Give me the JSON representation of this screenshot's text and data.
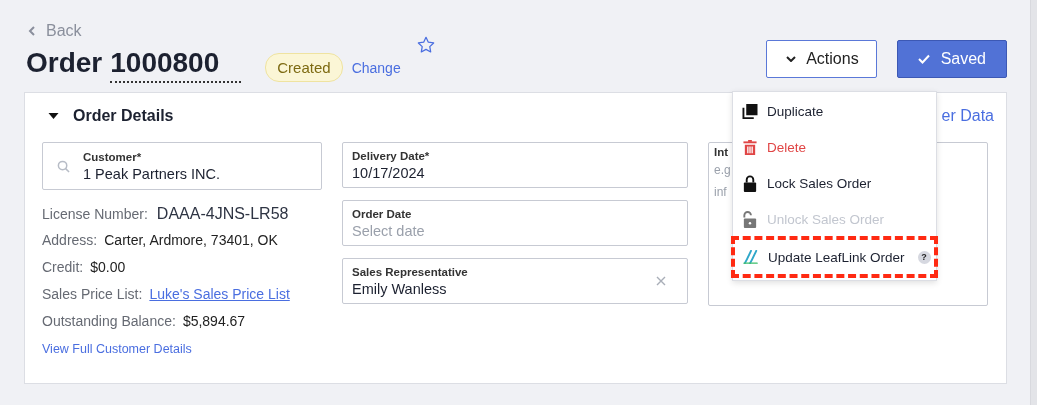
{
  "back": {
    "label": "Back"
  },
  "order": {
    "prefix": "Order",
    "number": "1000800",
    "status": "Created",
    "change_link": "Change",
    "favorite": false
  },
  "actions": {
    "label": "Actions",
    "expanded": true,
    "menu": [
      {
        "label": "Duplicate",
        "kind": "duplicate",
        "disabled": false,
        "highlighted": false
      },
      {
        "label": "Delete",
        "kind": "delete",
        "disabled": false,
        "highlighted": false
      },
      {
        "label": "Lock Sales Order",
        "kind": "lock",
        "disabled": false,
        "highlighted": false
      },
      {
        "label": "Unlock Sales Order",
        "kind": "unlock",
        "disabled": true,
        "highlighted": false
      },
      {
        "label": "Update LeafLink Order",
        "kind": "leaflink",
        "disabled": false,
        "highlighted": true,
        "help": "?"
      }
    ]
  },
  "save_button": {
    "label": "Saved"
  },
  "details": {
    "title": "Order Details",
    "expanded": true,
    "link": "er Data",
    "customer": {
      "label": "Customer*",
      "value": "1 Peak Partners INC."
    },
    "info": [
      {
        "label": "License Number:",
        "value": "DAAA-4JNS-LR58",
        "kind": "id"
      },
      {
        "label": "Address:",
        "value": "Carter, Ardmore, 73401, OK",
        "kind": "text"
      },
      {
        "label": "Credit:",
        "value": "$0.00",
        "kind": "text"
      },
      {
        "label": "Sales Price List:",
        "value": "Luke's Sales Price List",
        "kind": "link"
      },
      {
        "label": "Outstanding Balance:",
        "value": "$5,894.67",
        "kind": "text"
      }
    ],
    "view_link": "View Full Customer Details",
    "fields": [
      {
        "label": "Delivery Date*",
        "value": "10/17/2024",
        "clearable": false
      },
      {
        "label": "Order Date",
        "placeholder": "Select date",
        "clearable": false
      },
      {
        "label": "Sales Representative",
        "value": "Emily Wanless",
        "clearable": true
      }
    ],
    "notes": {
      "label": "Int",
      "placeholder_lines": [
        "e.g",
        "inf"
      ]
    }
  }
}
